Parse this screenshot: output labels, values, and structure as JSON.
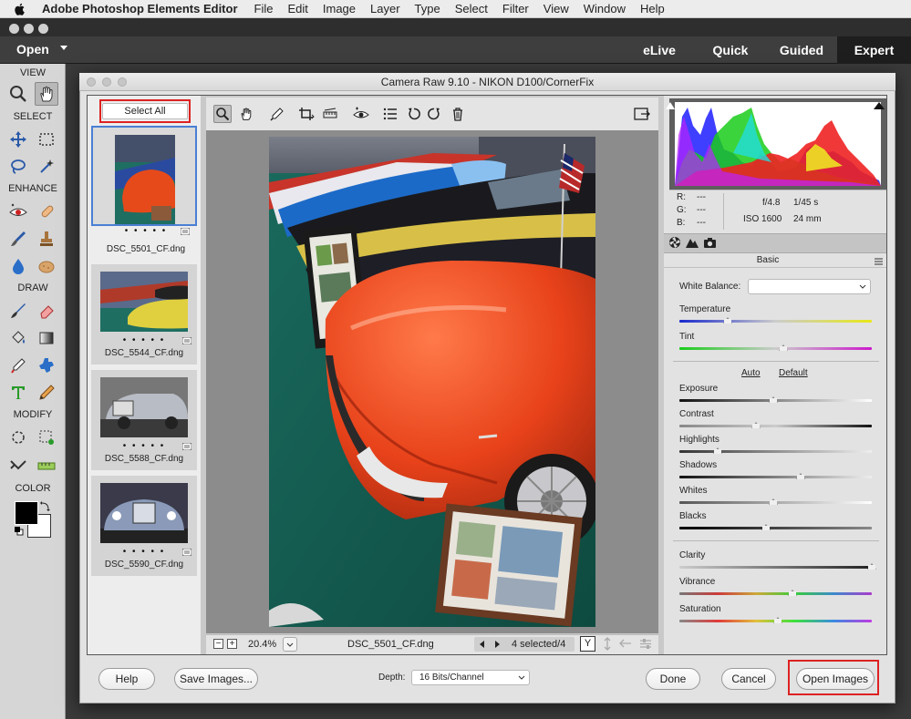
{
  "menubar": {
    "app_name": "Adobe Photoshop Elements Editor",
    "items": [
      "File",
      "Edit",
      "Image",
      "Layer",
      "Type",
      "Select",
      "Filter",
      "View",
      "Window",
      "Help"
    ]
  },
  "modebar": {
    "open_label": "Open",
    "modes": [
      "eLive",
      "Quick",
      "Guided",
      "Expert"
    ],
    "active_mode": "Expert"
  },
  "tools_panel": {
    "sections": [
      "VIEW",
      "SELECT",
      "ENHANCE",
      "DRAW",
      "MODIFY",
      "COLOR"
    ]
  },
  "dialog": {
    "title": "Camera Raw 9.10  -  NIKON D100/CornerFix"
  },
  "filmstrip": {
    "select_all_label": "Select All",
    "items": [
      {
        "name": "DSC_5501_CF.dng",
        "dots": "• • • • •",
        "selected": true
      },
      {
        "name": "DSC_5544_CF.dng",
        "dots": "• • • • •",
        "selected": false
      },
      {
        "name": "DSC_5588_CF.dng",
        "dots": "• • • • •",
        "selected": false
      },
      {
        "name": "DSC_5590_CF.dng",
        "dots": "• • • • •",
        "selected": false
      }
    ]
  },
  "statusbar": {
    "zoom": "20.4%",
    "filename": "DSC_5501_CF.dng",
    "selection": "4 selected/4",
    "view_toggle": "Y"
  },
  "readout": {
    "r_label": "R:",
    "r_value": "---",
    "g_label": "G:",
    "g_value": "---",
    "b_label": "B:",
    "b_value": "---",
    "aperture": "f/4.8",
    "shutter": "1/45 s",
    "iso": "ISO 1600",
    "focal": "24 mm"
  },
  "basic_panel": {
    "title": "Basic",
    "white_balance_label": "White Balance:",
    "white_balance_value": "",
    "auto_label": "Auto",
    "default_label": "Default",
    "sliders": [
      {
        "label": "Temperature",
        "position": 0.25
      },
      {
        "label": "Tint",
        "position": 0.54
      },
      {
        "label": "Exposure",
        "position": 0.49
      },
      {
        "label": "Contrast",
        "position": 0.4
      },
      {
        "label": "Highlights",
        "position": 0.2
      },
      {
        "label": "Shadows",
        "position": 0.63
      },
      {
        "label": "Whites",
        "position": 0.49
      },
      {
        "label": "Blacks",
        "position": 0.45
      },
      {
        "label": "Clarity",
        "position": 1.0
      },
      {
        "label": "Vibrance",
        "position": 0.59
      },
      {
        "label": "Saturation",
        "position": 0.51
      }
    ]
  },
  "buttons": {
    "help": "Help",
    "save_images": "Save Images...",
    "depth_label": "Depth:",
    "depth_value": "16 Bits/Channel",
    "done": "Done",
    "cancel": "Cancel",
    "open_images": "Open Images"
  },
  "colors": {
    "highlight_red": "#dd2222",
    "selection_blue": "#4a7fd4"
  }
}
